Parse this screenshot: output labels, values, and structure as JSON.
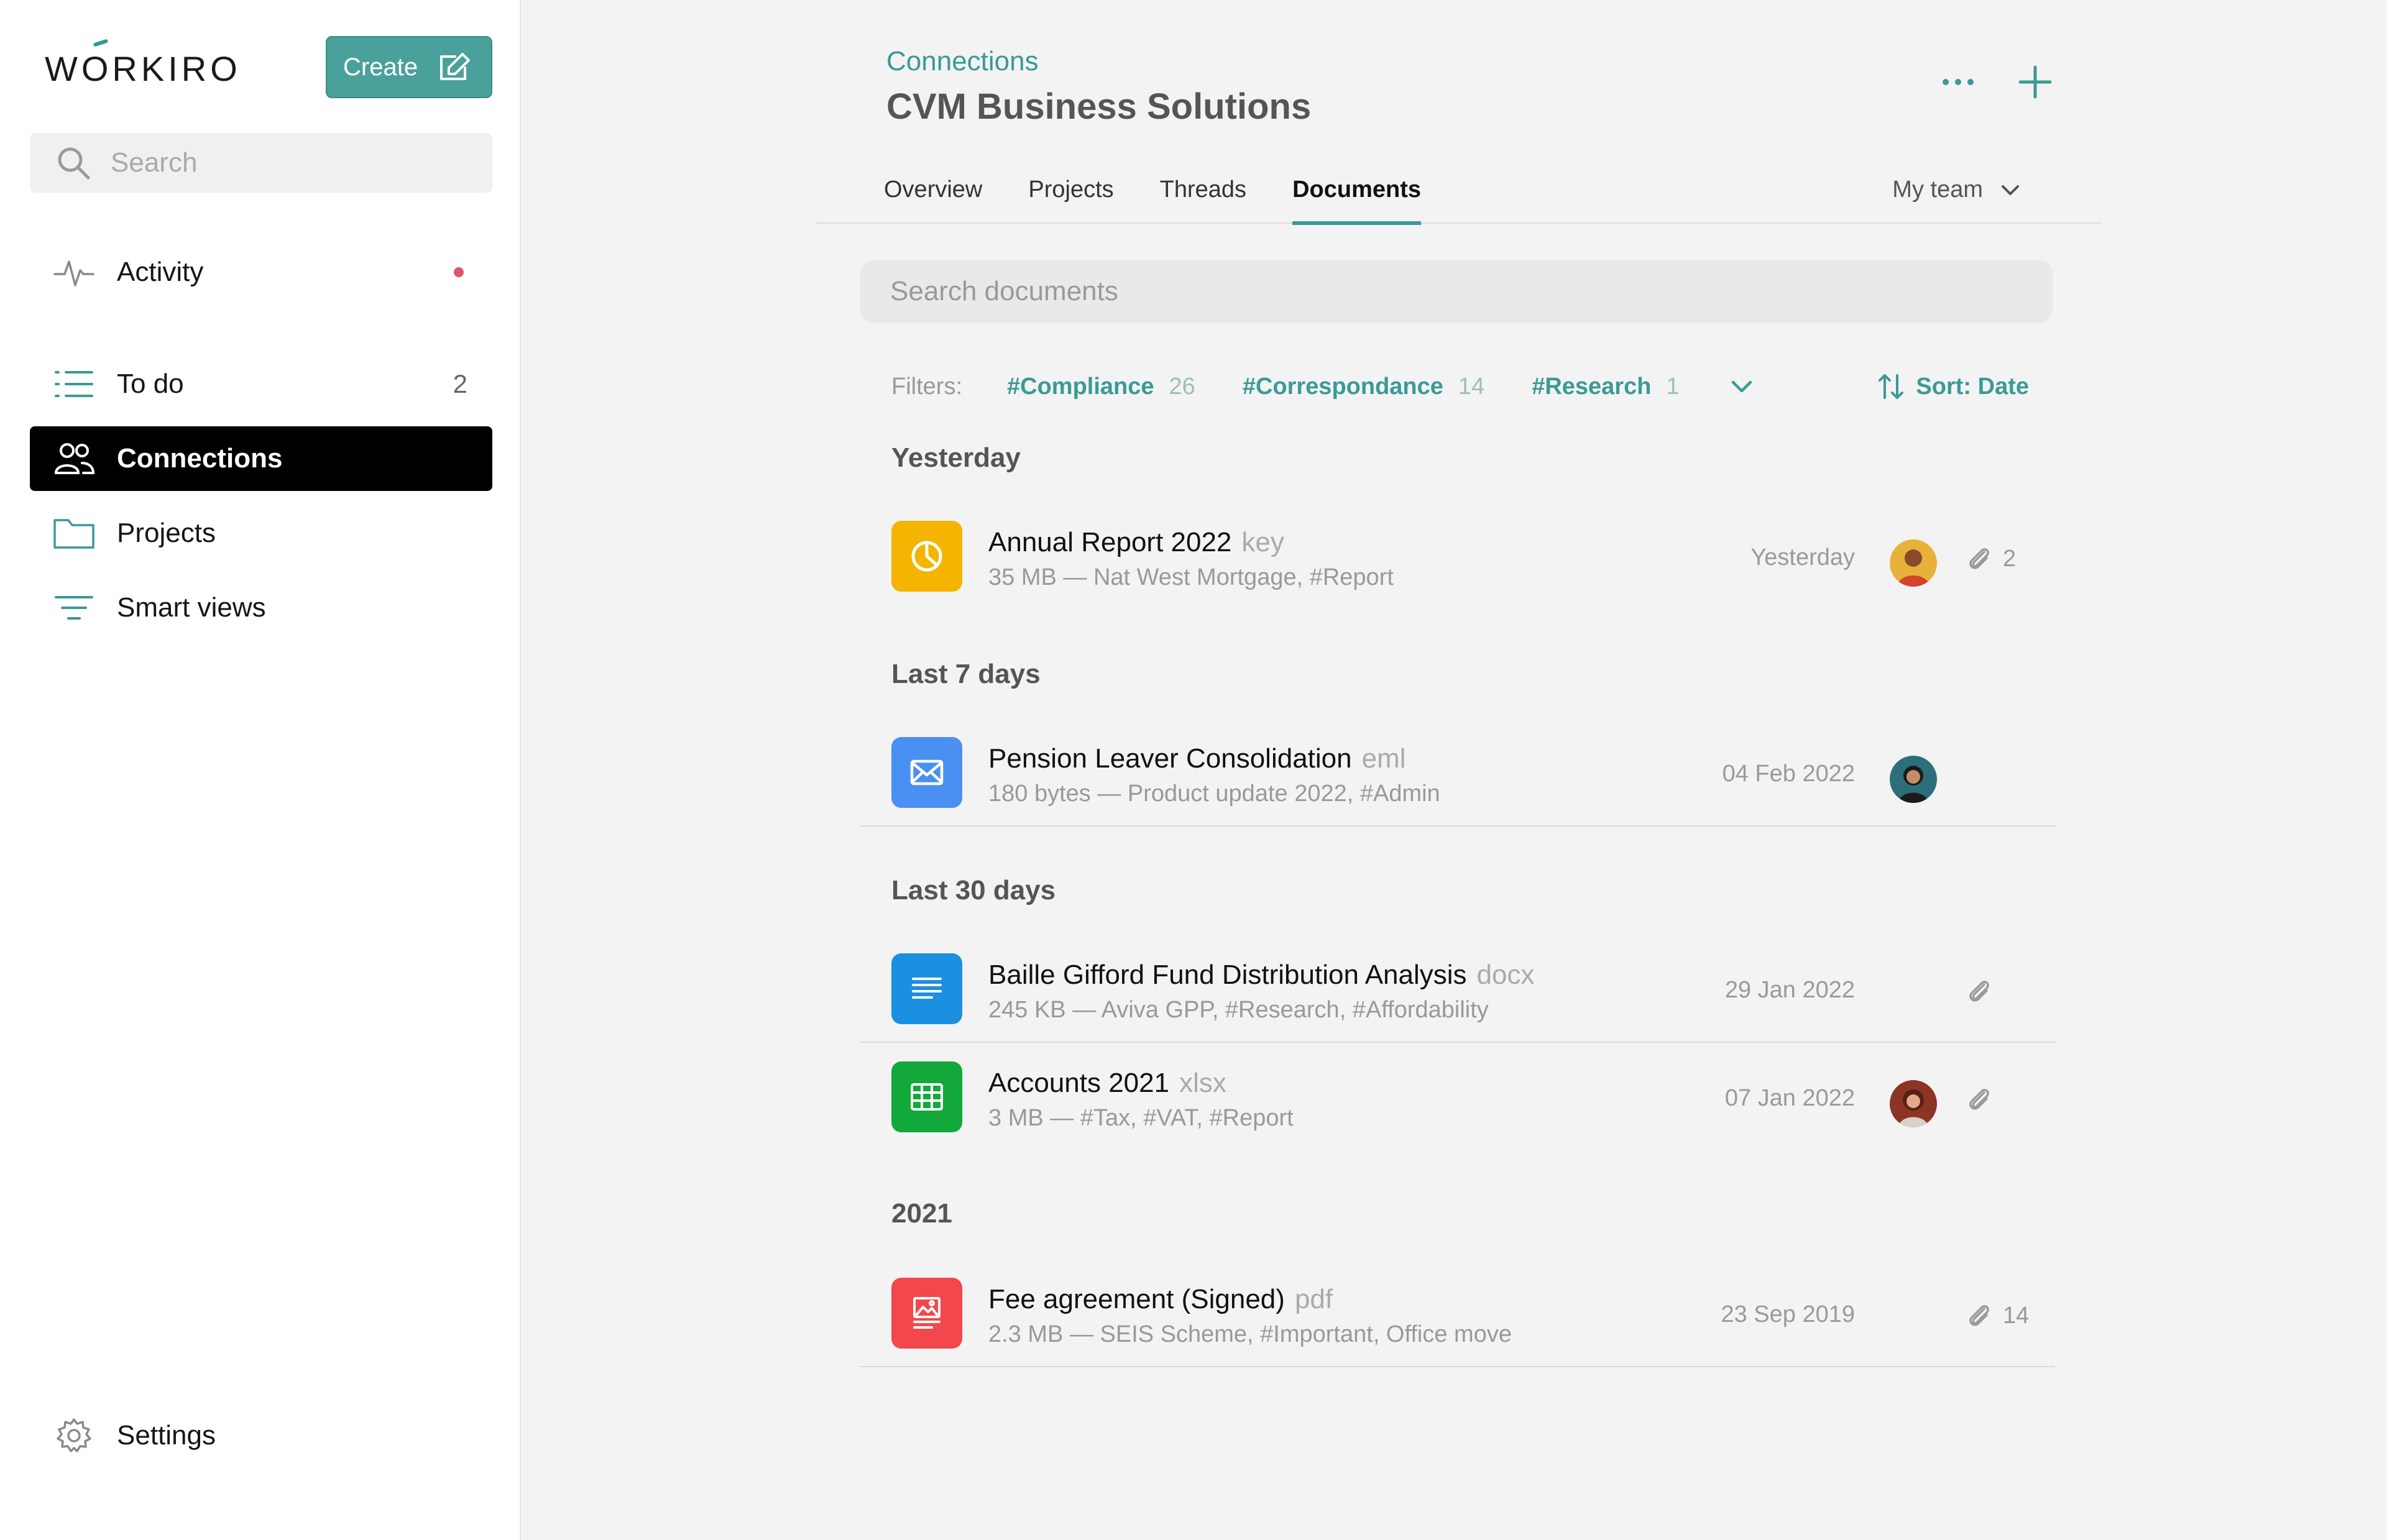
{
  "sidebar": {
    "logo": "WORKIRO",
    "create_label": "Create",
    "search_placeholder": "Search",
    "items": [
      {
        "label": "Activity"
      },
      {
        "label": "To do",
        "count": "2"
      },
      {
        "label": "Connections"
      },
      {
        "label": "Projects"
      },
      {
        "label": "Smart views"
      }
    ],
    "settings_label": "Settings"
  },
  "header": {
    "breadcrumb": "Connections",
    "title": "CVM Business Solutions"
  },
  "tabs": [
    "Overview",
    "Projects",
    "Threads",
    "Documents"
  ],
  "active_tab": "Documents",
  "team_select": "My team",
  "doc_search_placeholder": "Search documents",
  "filters": {
    "label": "Filters:",
    "chips": [
      {
        "name": "#Compliance",
        "count": "26"
      },
      {
        "name": "#Correspondance",
        "count": "14"
      },
      {
        "name": "#Research",
        "count": "1"
      }
    ],
    "sort_label": "Sort: Date"
  },
  "sections": [
    "Yesterday",
    "Last 7 days",
    "Last 30 days",
    "2021"
  ],
  "documents": [
    {
      "name": "Annual Report 2022",
      "ext": "key",
      "meta": "35 MB — Nat West Mortgage, #Report",
      "date": "Yesterday",
      "attachments": "2",
      "icon": "pie-chart-icon",
      "color": "#f4b400"
    },
    {
      "name": "Pension Leaver Consolidation",
      "ext": "eml",
      "meta": "180 bytes — Product update 2022, #Admin",
      "date": "04 Feb 2022",
      "attachments": "",
      "icon": "envelope-icon",
      "color": "#4a8ff2"
    },
    {
      "name": "Baille Gifford Fund Distribution Analysis",
      "ext": "docx",
      "meta": "245 KB — Aviva GPP, #Research, #Affordability",
      "date": "29 Jan 2022",
      "attachments": "",
      "icon": "document-lines-icon",
      "color": "#1b8fe0"
    },
    {
      "name": "Accounts 2021",
      "ext": "xlsx",
      "meta": "3 MB — #Tax, #VAT, #Report",
      "date": "07 Jan 2022",
      "attachments": "",
      "icon": "spreadsheet-icon",
      "color": "#12a83a"
    },
    {
      "name": "Fee agreement (Signed)",
      "ext": "pdf",
      "meta": "2.3 MB — SEIS Scheme, #Important, Office move",
      "date": "23 Sep 2019",
      "attachments": "14",
      "icon": "image-document-icon",
      "color": "#f1474d"
    }
  ],
  "colors": {
    "accent": "#3a9a96",
    "create_button": "#4aa19c",
    "active_nav": "#000000",
    "activity_dot": "#e0556b"
  }
}
